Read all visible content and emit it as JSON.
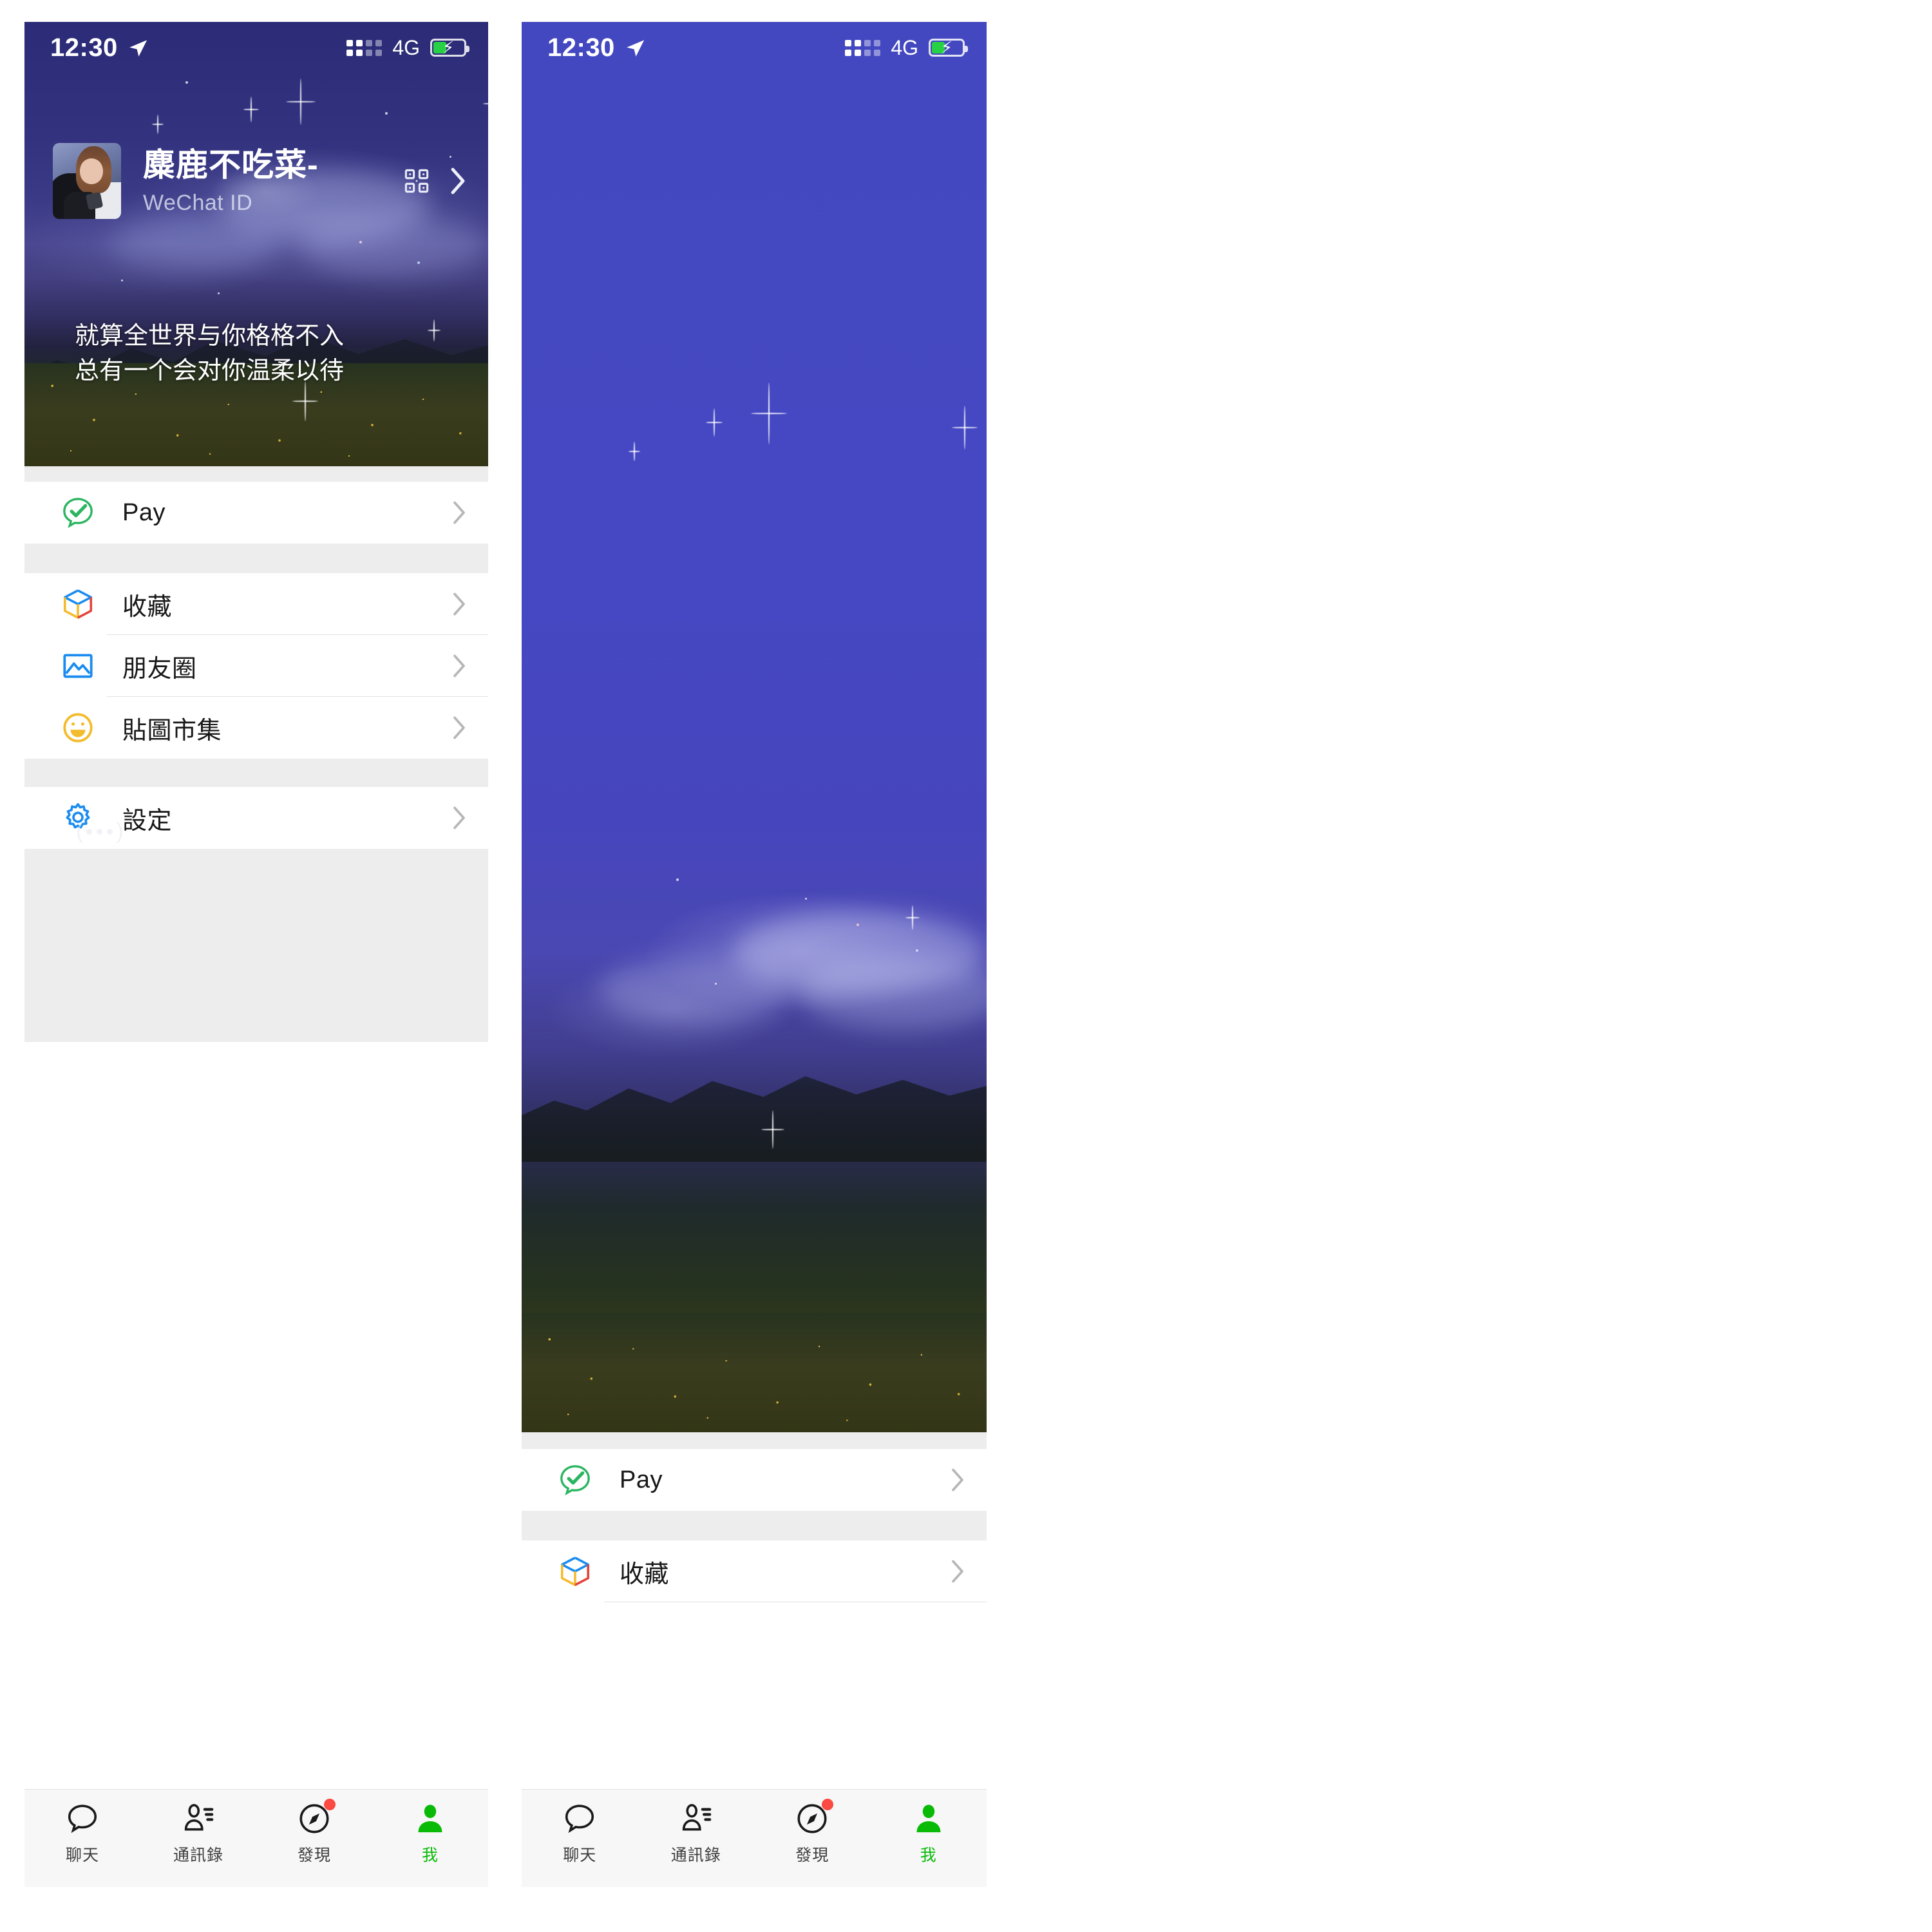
{
  "status_bar": {
    "time": "12:30",
    "location_icon": "location-arrow-icon",
    "signal_icon": "signal-strength-icon",
    "network": "4G",
    "battery_icon": "battery-charging-icon"
  },
  "profile": {
    "name": "麋鹿不吃菜-",
    "wechat_id": "WeChat ID",
    "qr_icon": "qr-code-icon",
    "chevron_icon": "chevron-right-icon",
    "avatar_icon": "avatar"
  },
  "signature": {
    "line1": "就算全世界与你格格不入",
    "line2": "总有一个会对你温柔以待"
  },
  "sound_indicator": "broadcast-sound-icon",
  "menu_groups": [
    {
      "items": [
        {
          "label": "Pay",
          "icon": "wechat-pay-icon",
          "icon_color": "#2bb561"
        }
      ]
    },
    {
      "items": [
        {
          "label": "收藏",
          "icon": "favorites-cube-icon",
          "icon_color": "#1a8cf0"
        },
        {
          "label": "朋友圈",
          "icon": "moments-photo-icon",
          "icon_color": "#1a8cf0"
        },
        {
          "label": "貼圖市集",
          "icon": "sticker-smiley-icon",
          "icon_color": "#f3bc2e"
        }
      ]
    },
    {
      "items": [
        {
          "label": "設定",
          "icon": "settings-gear-icon",
          "icon_color": "#1a8cf0"
        }
      ]
    }
  ],
  "tabs": [
    {
      "label": "聊天",
      "icon": "chat-bubble-icon",
      "active": false,
      "badge": false
    },
    {
      "label": "通訊錄",
      "icon": "contacts-icon",
      "active": false,
      "badge": false
    },
    {
      "label": "發現",
      "icon": "discover-compass-icon",
      "active": false,
      "badge": true
    },
    {
      "label": "我",
      "icon": "me-person-icon",
      "active": true,
      "badge": false
    }
  ],
  "colors": {
    "left_hero_top": "#2b2b77",
    "right_hero_top": "#4448c0",
    "accent_green": "#09bb07",
    "pay_green": "#2bb561",
    "badge_red": "#fa4a41",
    "list_bg": "#ffffff",
    "group_gap": "#ededed",
    "tabbar_bg": "#f7f7f7"
  },
  "right_panel_visible_menu_count": 2
}
